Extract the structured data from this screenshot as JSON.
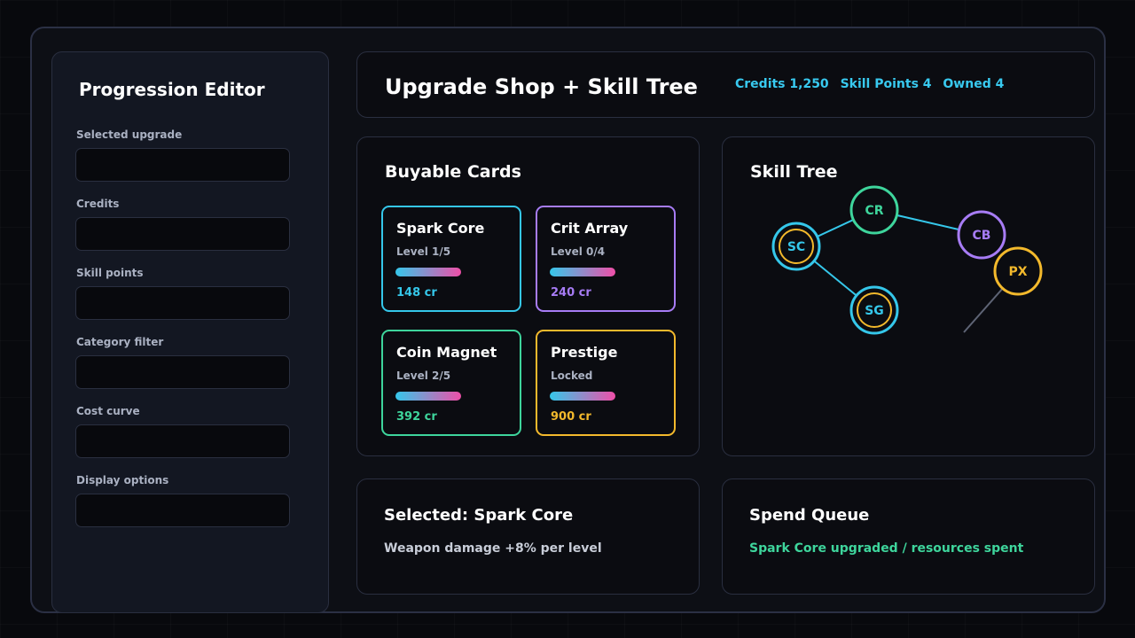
{
  "sidebar": {
    "title": "Progression Editor",
    "fields": [
      {
        "label": "Selected upgrade",
        "value": ""
      },
      {
        "label": "Credits",
        "value": ""
      },
      {
        "label": "Skill points",
        "value": ""
      },
      {
        "label": "Category filter",
        "value": ""
      },
      {
        "label": "Cost curve",
        "value": ""
      },
      {
        "label": "Display options",
        "value": ""
      }
    ]
  },
  "header": {
    "title": "Upgrade Shop + Skill Tree",
    "stats": {
      "credits": "Credits 1,250",
      "skill_points": "Skill Points 4",
      "owned": "Owned 4"
    }
  },
  "cards_panel": {
    "title": "Buyable Cards",
    "cards": [
      {
        "name": "Spark Core",
        "level": "Level 1/5",
        "cost": "148 cr",
        "color": "#35c7ea"
      },
      {
        "name": "Crit Array",
        "level": "Level 0/4",
        "cost": "240 cr",
        "color": "#a77cf5"
      },
      {
        "name": "Coin Magnet",
        "level": "Level 2/5",
        "cost": "392 cr",
        "color": "#3ed59c"
      },
      {
        "name": "Prestige",
        "level": "Locked",
        "cost": "900 cr",
        "color": "#f3b92c"
      }
    ]
  },
  "skill_tree": {
    "title": "Skill Tree",
    "nodes": [
      {
        "id": "SC",
        "label": "SC",
        "color": "#35c7ea",
        "selected": true
      },
      {
        "id": "CR",
        "label": "CR",
        "color": "#3ed59c"
      },
      {
        "id": "CB",
        "label": "CB",
        "color": "#a77cf5"
      },
      {
        "id": "PX",
        "label": "PX",
        "color": "#f3b92c"
      },
      {
        "id": "SG",
        "label": "SG",
        "color": "#35c7ea",
        "selected": true
      }
    ]
  },
  "selected_panel": {
    "title": "Selected: Spark Core",
    "description": "Weapon damage +8% per level"
  },
  "queue_panel": {
    "title": "Spend Queue",
    "message": "Spark Core upgraded / resources spent"
  },
  "colors": {
    "accent_cyan": "#35c7ea",
    "accent_green": "#3ed59c",
    "accent_purple": "#a77cf5",
    "accent_gold": "#f3b92c",
    "accent_pink": "#ef4fa8"
  }
}
